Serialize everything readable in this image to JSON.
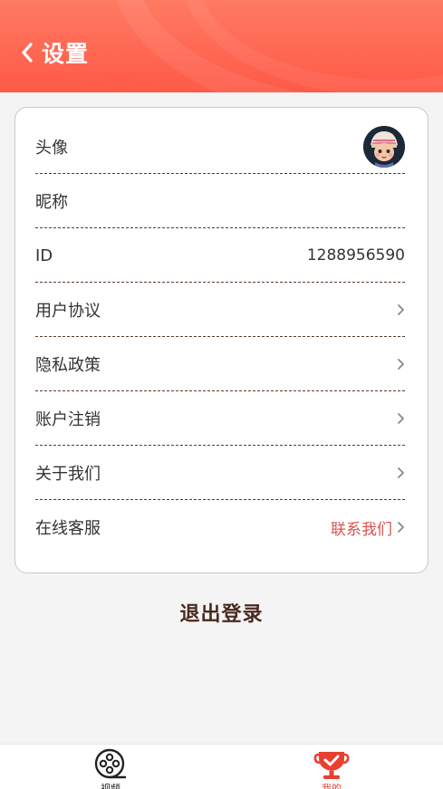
{
  "header": {
    "title": "设置",
    "back_icon": "chevron-left-icon",
    "colors": {
      "gradient_start": "#ff7a62",
      "gradient_end": "#ff5a48"
    }
  },
  "settings": {
    "avatar_label": "头像",
    "nickname_label": "昵称",
    "id_label": "ID",
    "id_value": "1288956590",
    "user_agreement_label": "用户协议",
    "privacy_policy_label": "隐私政策",
    "account_cancel_label": "账户注销",
    "about_label": "关于我们",
    "customer_service_label": "在线客服",
    "customer_service_action": "联系我们"
  },
  "logout_label": "退出登录",
  "tabbar": {
    "tabs": [
      {
        "label": "视频",
        "icon": "film-reel-icon",
        "active": false
      },
      {
        "label": "我的",
        "icon": "trophy-check-icon",
        "active": true
      }
    ],
    "active_color": "#e8402f"
  }
}
